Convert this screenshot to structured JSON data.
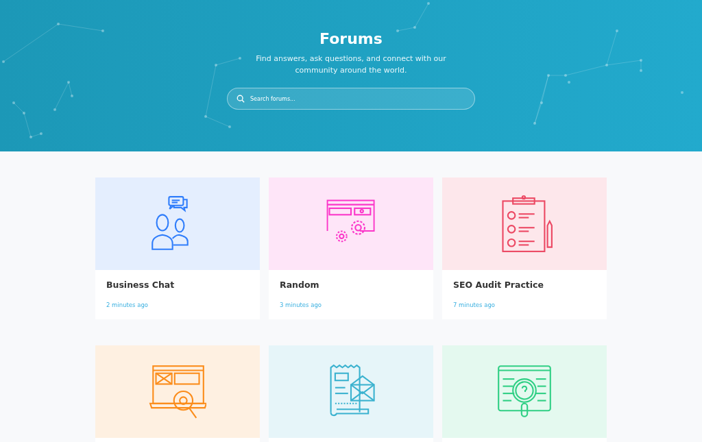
{
  "header": {
    "title": "Forums",
    "subtitle": "Find answers, ask questions, and connect with our community around the world.",
    "search": {
      "placeholder": "Search forums..."
    }
  },
  "forums": [
    {
      "title": "Business Chat",
      "time": "2 minutes ago",
      "color": "#2f7dfb"
    },
    {
      "title": "Random",
      "time": "3 minutes ago",
      "color": "#fb36c9"
    },
    {
      "title": "SEO Audit Practice",
      "time": "7 minutes ago",
      "color": "#ec4863"
    },
    {
      "color": "#fb8c1a"
    },
    {
      "color": "#3bb2cf"
    },
    {
      "color": "#2fcf84"
    }
  ]
}
